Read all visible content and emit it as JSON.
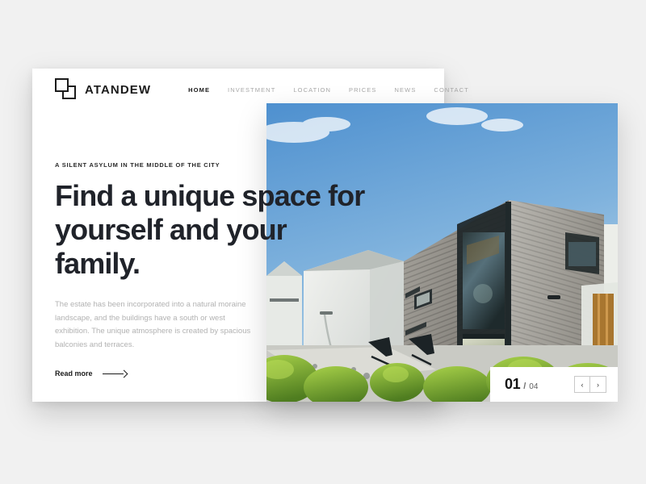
{
  "page": {
    "background_color": "#f1f1f1",
    "card_color": "#ffffff",
    "accent_color": "#1b1b1b",
    "muted_color": "#b2b2b2"
  },
  "header": {
    "logo_icon": "overlapping-squares-logo",
    "brand_name": "ATANDEW",
    "nav": [
      {
        "label": "HOME",
        "active": true
      },
      {
        "label": "INVESTMENT",
        "active": false
      },
      {
        "label": "LOCATION",
        "active": false
      },
      {
        "label": "PRICES",
        "active": false
      },
      {
        "label": "NEWS",
        "active": false
      },
      {
        "label": "CONTACT",
        "active": false
      }
    ]
  },
  "hero": {
    "eyebrow": "A SILENT ASYLUM IN THE MIDDLE OF THE CITY",
    "headline": "Find a unique space for yourself and your family.",
    "paragraph": "The estate has been incorporated into a natural moraine landscape, and the buildings have a south or west exhibition. The unique atmosphere is created by spacious balconies and terraces.",
    "cta_label": "Read more",
    "cta_icon": "long-right-arrow-icon"
  },
  "photo": {
    "alt": "Modern two-storey house with grey horizontal wood cladding, tall glass stairwell window, white stucco tower, blue sky and green shrubs",
    "sky_color": "#6ea6dc",
    "cladding_color": "#9a9791",
    "stucco_color": "#e8e9e4",
    "foliage_color": "#8cc03a"
  },
  "slider": {
    "current": "01",
    "separator": "/",
    "total": "04",
    "prev_icon": "chevron-left-icon",
    "prev_glyph": "‹",
    "next_icon": "chevron-right-icon",
    "next_glyph": "›"
  }
}
